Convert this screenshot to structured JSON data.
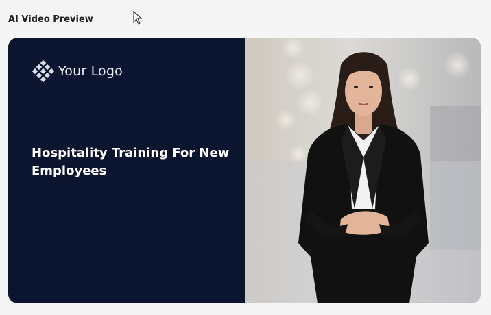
{
  "section": {
    "title": "AI Video Preview"
  },
  "preview": {
    "logo_text": "Your Logo",
    "video_title": "Hospitality Training For New Employees",
    "background_color": "#0c1530"
  },
  "icons": {
    "cursor": "mouse-pointer-icon",
    "logo": "diamond-cluster-logo-icon"
  }
}
